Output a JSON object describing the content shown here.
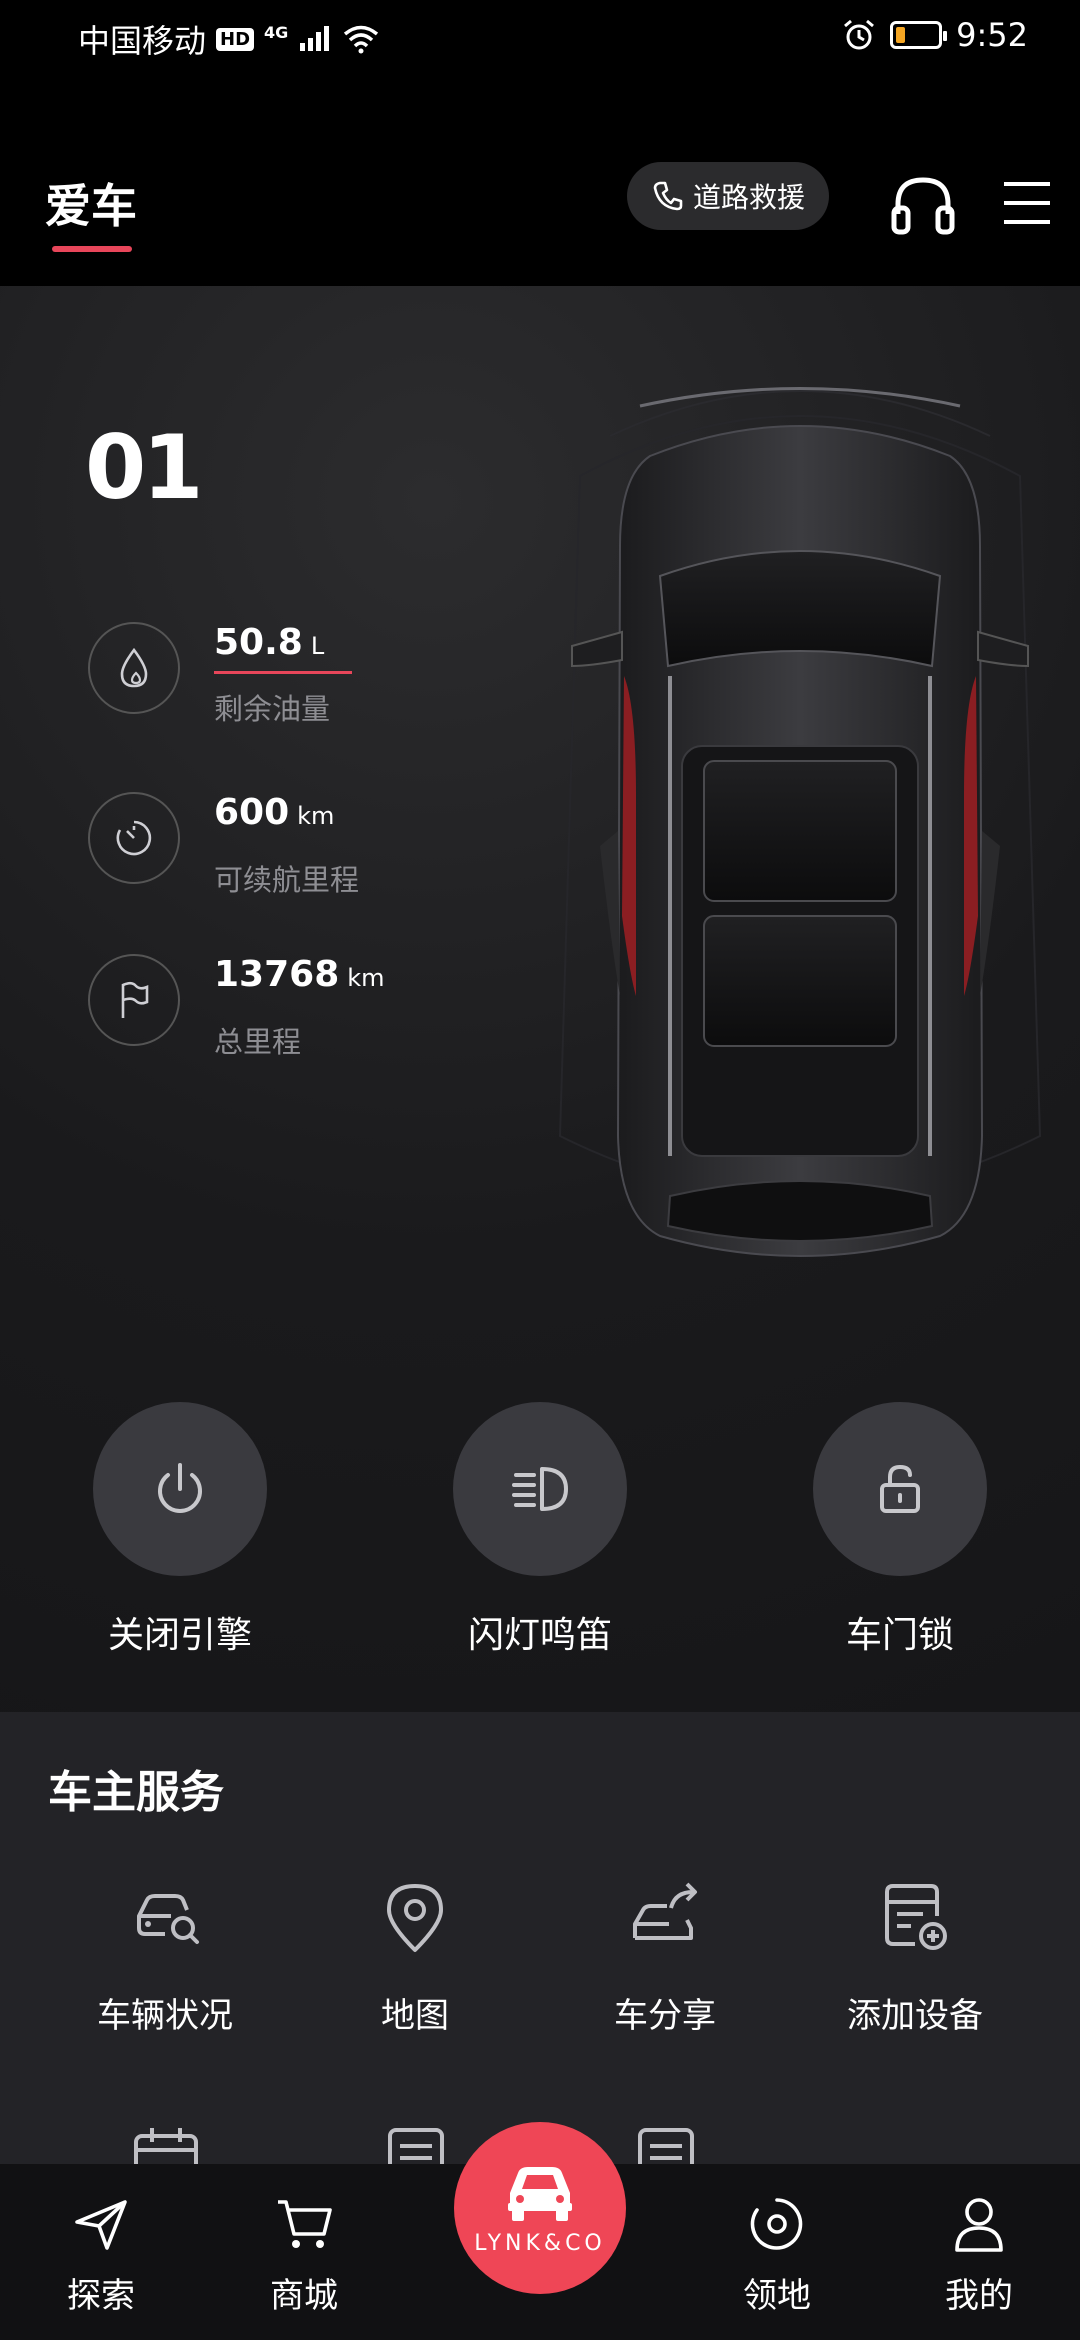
{
  "status_bar": {
    "carrier": "中国移动",
    "hd": "HD",
    "network": "4G",
    "time": "9:52",
    "battery_level": 0.2
  },
  "header": {
    "title": "爱车",
    "rescue_label": "道路救援"
  },
  "vehicle": {
    "model": "01",
    "stats": [
      {
        "value": "50.8",
        "unit": "L",
        "label": "剩余油量",
        "icon": "fuel-drop-icon"
      },
      {
        "value": "600",
        "unit": "km",
        "label": "可续航里程",
        "icon": "range-gauge-icon"
      },
      {
        "value": "13768",
        "unit": "km",
        "label": "总里程",
        "icon": "flag-icon"
      }
    ]
  },
  "actions": [
    {
      "label": "关闭引擎",
      "icon": "power-icon"
    },
    {
      "label": "闪灯鸣笛",
      "icon": "headlight-icon"
    },
    {
      "label": "车门锁",
      "icon": "unlock-icon"
    }
  ],
  "services": {
    "title": "车主服务",
    "items": [
      {
        "label": "车辆状况",
        "icon": "car-search-icon"
      },
      {
        "label": "地图",
        "icon": "map-pin-icon"
      },
      {
        "label": "车分享",
        "icon": "car-share-icon"
      },
      {
        "label": "添加设备",
        "icon": "add-device-icon"
      }
    ]
  },
  "bottom_nav": {
    "items": [
      {
        "label": "探索",
        "icon": "send-icon"
      },
      {
        "label": "商城",
        "icon": "cart-icon"
      },
      {
        "label": "领地",
        "icon": "territory-icon"
      },
      {
        "label": "我的",
        "icon": "person-icon"
      }
    ],
    "center_brand": "LYNK&CO"
  },
  "colors": {
    "accent": "#ef4656",
    "background": "#000000",
    "panel": "#1c1c1e",
    "services_bg": "#232327",
    "action_circle": "#3a3a3f",
    "muted_text": "#8e8e93"
  }
}
